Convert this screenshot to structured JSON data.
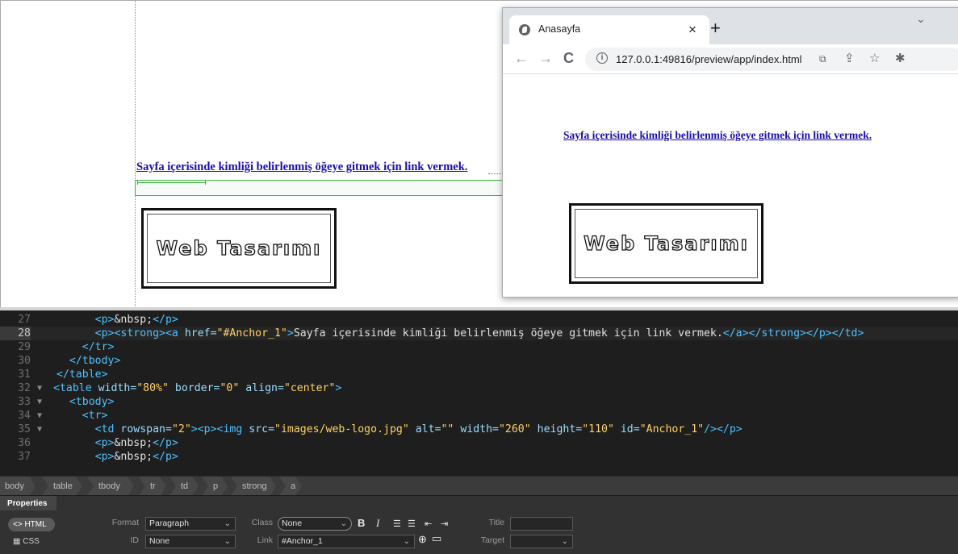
{
  "design_view": {
    "link_text": "Sayfa içerisinde kimliği belirlenmiş öğeye gitmek için link vermek.",
    "logo_text": "Web Tasarımı"
  },
  "browser": {
    "tab_title": "Anasayfa",
    "tab_close": "×",
    "new_tab": "+",
    "dropdown": "⌄",
    "back": "←",
    "forward": "→",
    "reload": "C",
    "info": "i",
    "url": "127.0.0.1:49816/preview/app/index.html",
    "translate_icon": "⧉",
    "share_icon": "⇪",
    "star_icon": "☆",
    "ext_icon": "✱",
    "link_text": "Sayfa içerisinde kimliği belirlenmiş öğeye gitmek için link vermek.",
    "logo_text": "Web Tasarımı"
  },
  "code": {
    "line_numbers": [
      "27",
      "28",
      "29",
      "30",
      "31",
      "32",
      "33",
      "34",
      "35",
      "36",
      "37"
    ],
    "fold_markers": [
      "",
      "",
      "",
      "",
      "",
      "▼",
      "▼",
      "▼",
      "▼",
      "",
      ""
    ]
  },
  "tag_selector": [
    "body",
    "table",
    "tbody",
    "tr",
    "td",
    "p",
    "strong",
    "a"
  ],
  "properties": {
    "title": "Properties",
    "html_btn": "<> HTML",
    "css_btn": "CSS",
    "format_label": "Format",
    "format_value": "Paragraph",
    "id_label": "ID",
    "id_value": "None",
    "class_label": "Class",
    "class_value": "None",
    "link_label": "Link",
    "link_value": "#Anchor_1",
    "title_label": "Title",
    "title_value": "",
    "target_label": "Target",
    "target_value": "",
    "bold": "B",
    "italic": "I",
    "ul": "☰",
    "ol": "☰",
    "outdent": "⇤",
    "indent": "⇥",
    "caret": "⌄",
    "point_icon": "⊕",
    "folder_icon": "▭"
  }
}
